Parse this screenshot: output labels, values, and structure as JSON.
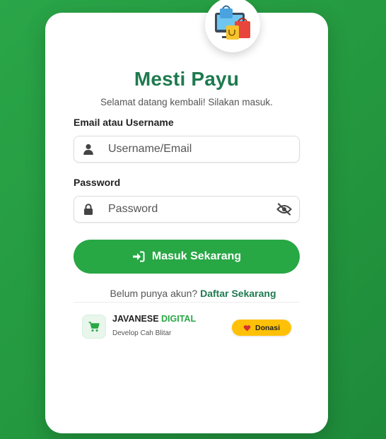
{
  "app": {
    "title": "Mesti Payu",
    "subtitle": "Selamat datang kembali! Silakan masuk."
  },
  "form": {
    "email_label": "Email atau Username",
    "email_placeholder": "Username/Email",
    "email_icon": "user-icon",
    "password_label": "Password",
    "password_placeholder": "Password",
    "password_icon": "lock-icon",
    "toggle_icon": "eye-slash-icon",
    "submit_label": "Masuk Sekarang",
    "submit_icon": "sign-in-icon"
  },
  "register": {
    "prompt": "Belum punya akun?",
    "link_label": "Daftar Sekarang"
  },
  "footer": {
    "brand_part1": "JAVANESE",
    "brand_part2": "DIGITAL",
    "tagline": "Develop Cah Blitar",
    "donate_label": "Donasi",
    "donate_icon": "heart-icon",
    "cart_icon": "cart-icon"
  },
  "colors": {
    "background": "#28a745",
    "brand_green": "#1e7a4f",
    "button_green": "#28a745",
    "donate_yellow": "#ffc107"
  }
}
